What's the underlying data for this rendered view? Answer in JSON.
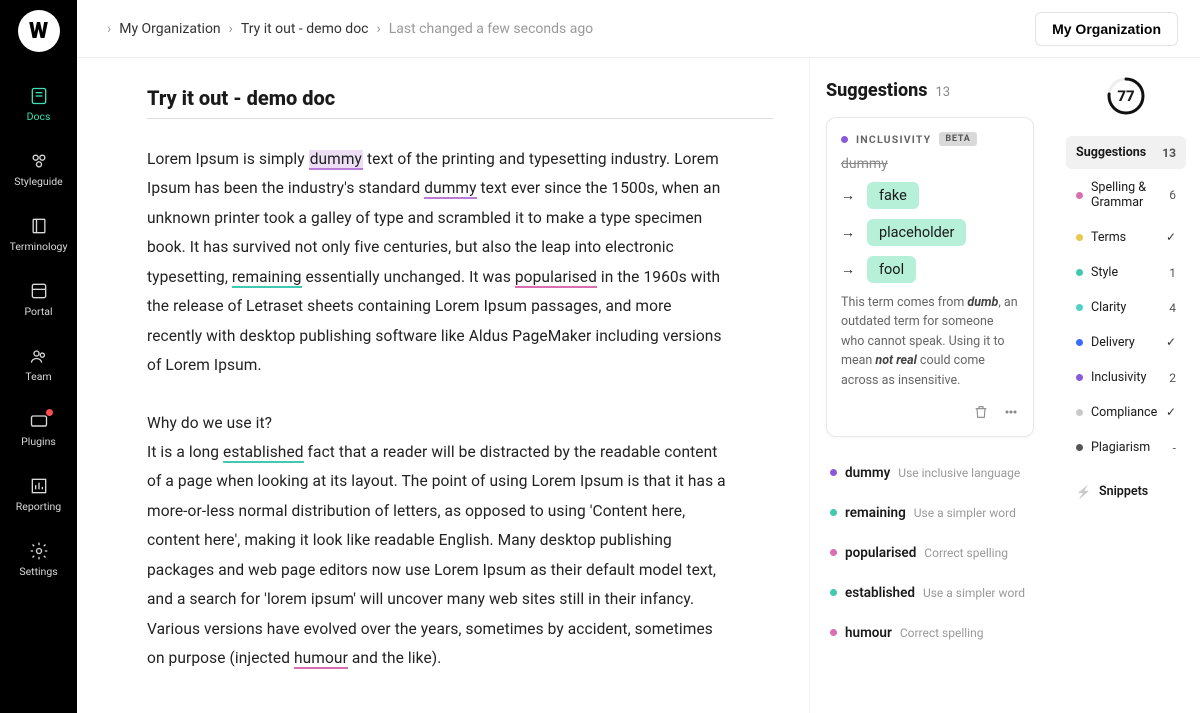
{
  "sidebar": {
    "items": [
      {
        "label": "Docs",
        "active": true
      },
      {
        "label": "Styleguide"
      },
      {
        "label": "Terminology"
      },
      {
        "label": "Portal"
      },
      {
        "label": "Team"
      },
      {
        "label": "Plugins",
        "notif": true
      },
      {
        "label": "Reporting"
      },
      {
        "label": "Settings"
      }
    ]
  },
  "breadcrumb": {
    "org": "My Organization",
    "doc": "Try it out - demo doc",
    "status": "Last changed a few seconds ago"
  },
  "org_button": "My Organization",
  "document": {
    "title": "Try it out - demo doc"
  },
  "suggestions_panel": {
    "title": "Suggestions",
    "count": "13",
    "card": {
      "category": "INCLUSIVITY",
      "tag": "BETA",
      "dot_color": "#8a5bd9",
      "struck": "dummy",
      "replacements": [
        "fake",
        "placeholder",
        "fool"
      ],
      "desc_pre": "This term comes from ",
      "desc_bold1": "dumb",
      "desc_mid": ", an outdated term for someone who cannot speak. Using it to mean ",
      "desc_bold2": "not real",
      "desc_post": " could come across as insensitive."
    },
    "list": [
      {
        "color": "#8a5bd9",
        "word": "dummy",
        "hint": "Use inclusive language"
      },
      {
        "color": "#3fc9b0",
        "word": "remaining",
        "hint": "Use a simpler word"
      },
      {
        "color": "#d96fb0",
        "word": "popularised",
        "hint": "Correct spelling"
      },
      {
        "color": "#3fc9b0",
        "word": "established",
        "hint": "Use a simpler word"
      },
      {
        "color": "#d96fb0",
        "word": "humour",
        "hint": "Correct spelling"
      }
    ]
  },
  "score": 77,
  "categories": {
    "head": {
      "label": "Suggestions",
      "val": "13"
    },
    "rows": [
      {
        "color": "#d96fb0",
        "label": "Spelling & Grammar",
        "val": "6"
      },
      {
        "color": "#e6c84a",
        "label": "Terms",
        "check": true
      },
      {
        "color": "#3fc9b0",
        "label": "Style",
        "val": "1"
      },
      {
        "color": "#4fd1c5",
        "label": "Clarity",
        "val": "4"
      },
      {
        "color": "#3a6cff",
        "label": "Delivery",
        "check": true
      },
      {
        "color": "#8a5bd9",
        "label": "Inclusivity",
        "val": "2"
      },
      {
        "color": "#c9c9c9",
        "label": "Compliance",
        "check": true
      },
      {
        "color": "#555",
        "label": "Plagiarism",
        "val": "-"
      }
    ]
  },
  "snippets": "Snippets"
}
